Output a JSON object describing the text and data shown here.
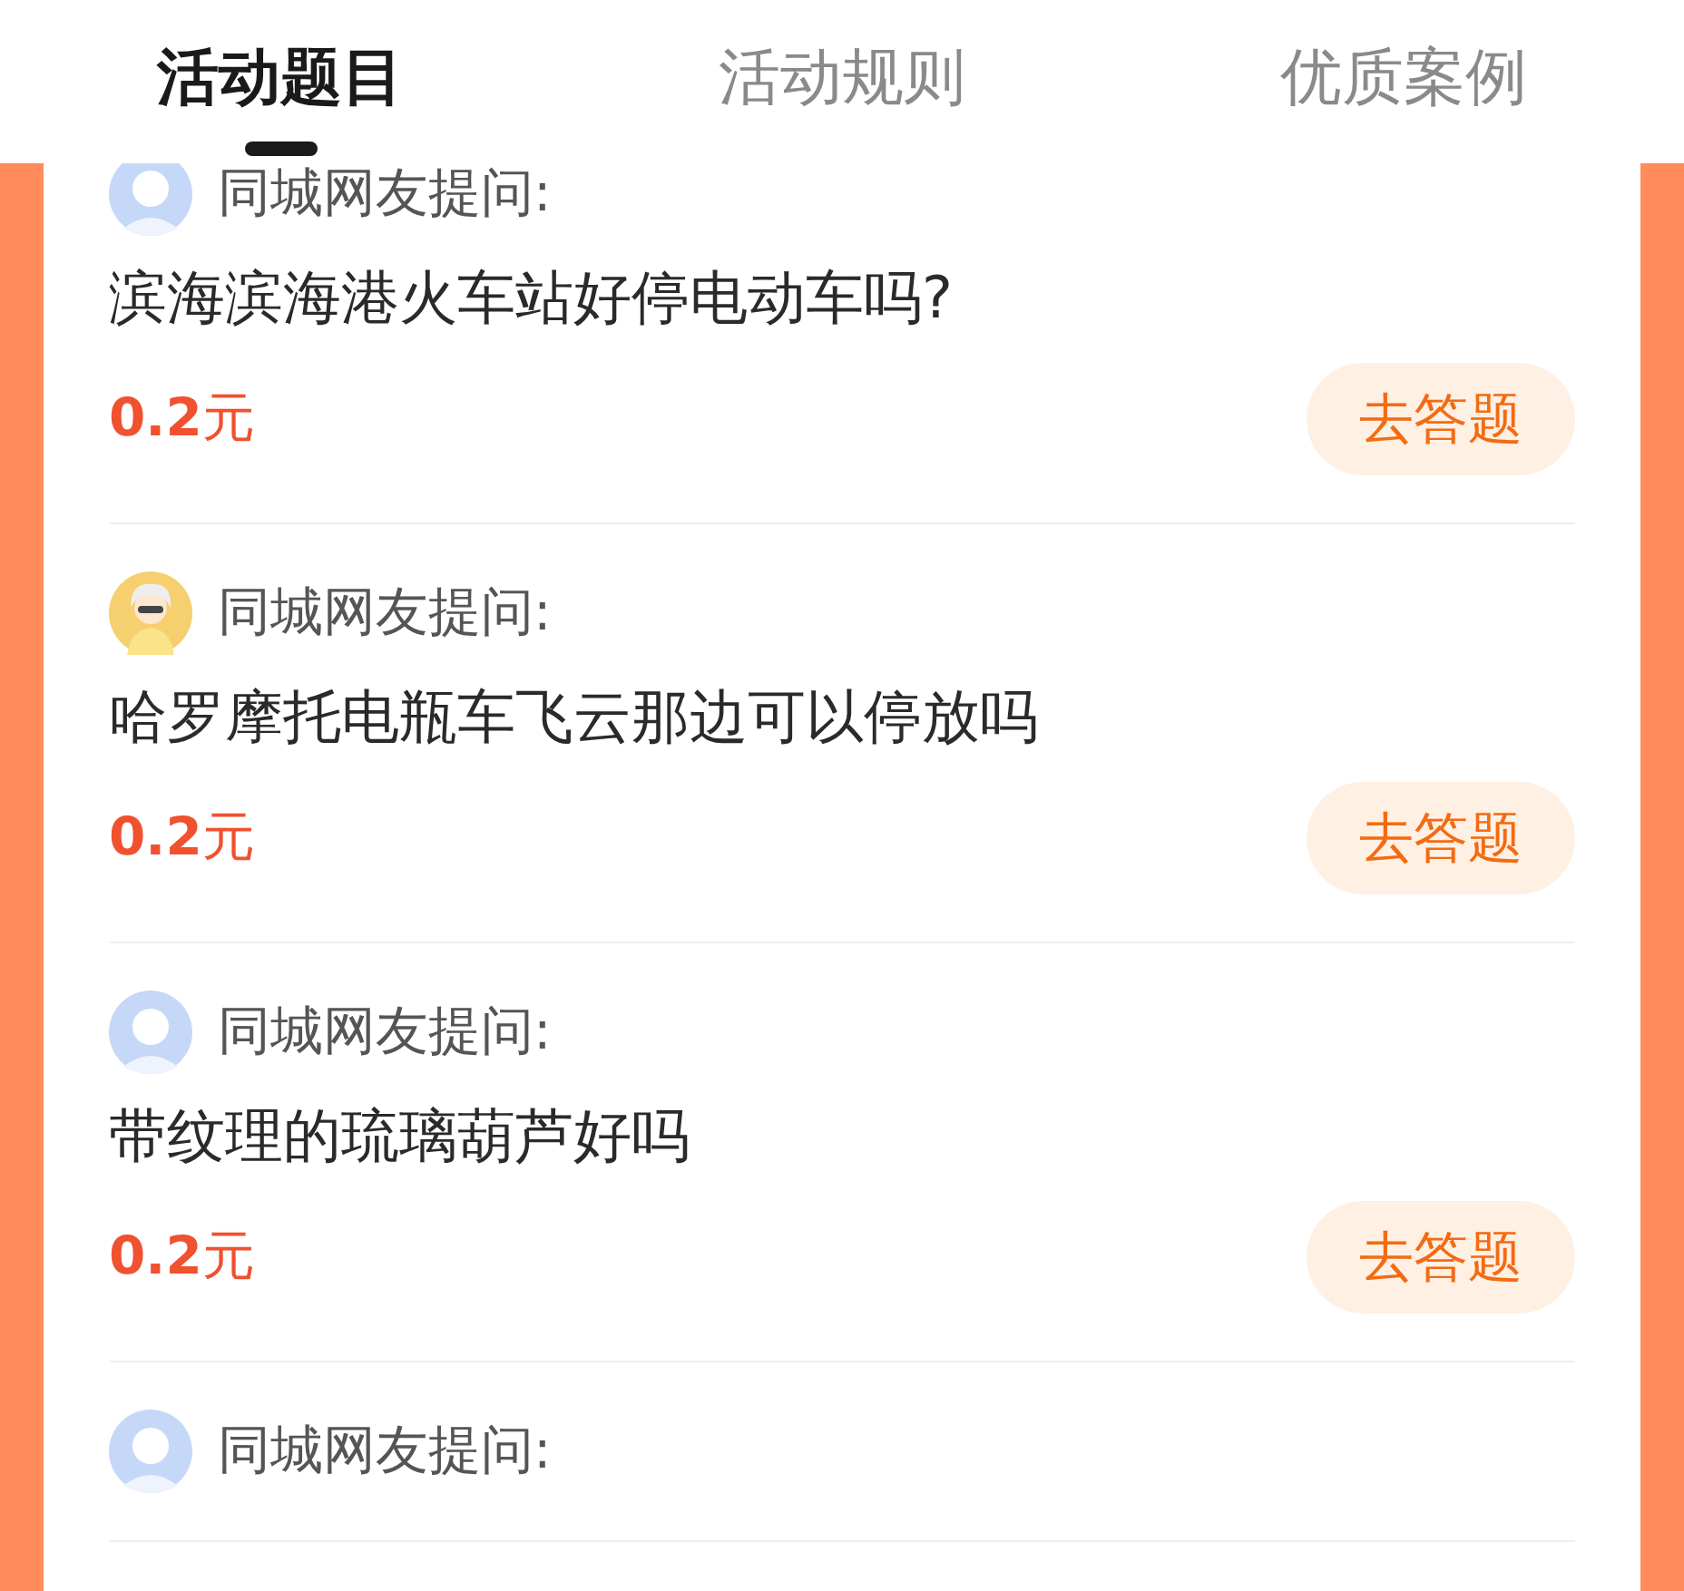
{
  "tabs": [
    {
      "label": "活动题目",
      "selected": true
    },
    {
      "label": "活动规则",
      "selected": false
    },
    {
      "label": "优质案例",
      "selected": false
    }
  ],
  "questions": [
    {
      "kind": "default",
      "asker": "同城网友提问:",
      "question": "滨海滨海港火车站好停电动车吗?",
      "reward": "0.2",
      "unit": "元",
      "button": "去答题"
    },
    {
      "kind": "cartoon",
      "asker": "同城网友提问:",
      "question": "哈罗摩托电瓶车飞云那边可以停放吗",
      "reward": "0.2",
      "unit": "元",
      "button": "去答题"
    },
    {
      "kind": "default",
      "asker": "同城网友提问:",
      "question": "带纹理的琉璃葫芦好吗",
      "reward": "0.2",
      "unit": "元",
      "button": "去答题"
    },
    {
      "kind": "default",
      "asker": "同城网友提问:"
    }
  ]
}
